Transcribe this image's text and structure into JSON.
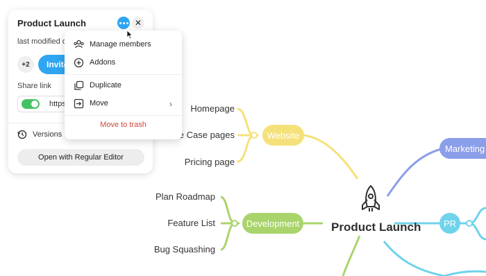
{
  "panel": {
    "title": "Product Launch",
    "modified": "last modified or",
    "member_count": "+2",
    "invite_label": "Invite",
    "share_label": "Share link",
    "share_value": "https",
    "versions_label": "Versions",
    "open_button": "Open with Regular Editor"
  },
  "menu": {
    "items": [
      {
        "label": "Manage members",
        "icon": "members-icon"
      },
      {
        "label": "Addons",
        "icon": "plus-circle-icon"
      },
      {
        "label": "Duplicate",
        "icon": "duplicate-icon"
      },
      {
        "label": "Move",
        "icon": "move-icon"
      }
    ],
    "trash_label": "Move to trash"
  },
  "mindmap": {
    "root": "Product Launch",
    "branches": {
      "website": {
        "label": "Website",
        "color": "#f5e17a",
        "children": [
          "Homepage",
          "Use Case pages",
          "Pricing page"
        ]
      },
      "development": {
        "label": "Development",
        "color": "#a9d46b",
        "children": [
          "Plan Roadmap",
          "Feature List",
          "Bug Squashing"
        ]
      },
      "marketing": {
        "label": "Marketing",
        "color": "#8b9eea"
      },
      "pr": {
        "label": "PR",
        "color": "#6fd3ec"
      }
    }
  },
  "colors": {
    "accent": "#2fa6f2",
    "toggle_on": "#46c266",
    "danger": "#d0453a"
  }
}
